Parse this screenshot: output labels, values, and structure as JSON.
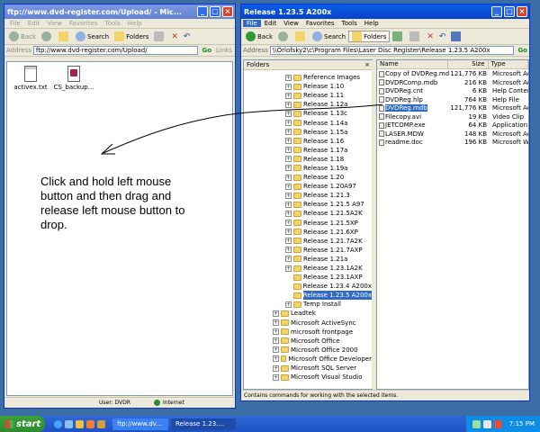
{
  "left_window": {
    "title": "ftp://www.dvd-register.com/Upload/ - Mic...",
    "menu": [
      "File",
      "Edit",
      "View",
      "Favorites",
      "Tools",
      "Help"
    ],
    "toolbar": {
      "back": "Back",
      "search": "Search",
      "folders": "Folders"
    },
    "address_label": "Address",
    "address_value": "ftp://www.dvd-register.com/Upload/",
    "go": "Go",
    "links": "Links",
    "files": [
      {
        "name": "activex.txt",
        "icon": "text-file-icon"
      },
      {
        "name": "CS_backup...",
        "icon": "access-file-icon"
      }
    ],
    "status_user": "User: DVDR",
    "status_zone": "Internet"
  },
  "right_window": {
    "title": "Release 1.23.5 A200x",
    "menu": [
      "File",
      "Edit",
      "View",
      "Favorites",
      "Tools",
      "Help"
    ],
    "toolbar": {
      "back": "Back",
      "search": "Search",
      "folders": "Folders"
    },
    "address_label": "Address",
    "address_value": "\\\\Orlofsky2\\c\\Program Files\\Laser Disc Register\\Release 1.23.5 A200x",
    "go": "Go",
    "folders_header": "Folders",
    "tree": [
      {
        "label": "Reference Images",
        "level": 2,
        "expander": "+"
      },
      {
        "label": "Release 1.10",
        "level": 2,
        "expander": "+"
      },
      {
        "label": "Release 1.11",
        "level": 2,
        "expander": "+"
      },
      {
        "label": "Release 1.12a",
        "level": 2,
        "expander": "+"
      },
      {
        "label": "Release 1.13c",
        "level": 2,
        "expander": "+"
      },
      {
        "label": "Release 1.14a",
        "level": 2,
        "expander": "+"
      },
      {
        "label": "Release 1.15a",
        "level": 2,
        "expander": "+"
      },
      {
        "label": "Release 1.16",
        "level": 2,
        "expander": "+"
      },
      {
        "label": "Release 1.17a",
        "level": 2,
        "expander": "+"
      },
      {
        "label": "Release 1.18",
        "level": 2,
        "expander": "+"
      },
      {
        "label": "Release 1.19a",
        "level": 2,
        "expander": "+"
      },
      {
        "label": "Release 1.20",
        "level": 2,
        "expander": "+"
      },
      {
        "label": "Release 1.20A97",
        "level": 2,
        "expander": "+"
      },
      {
        "label": "Release 1.21.3",
        "level": 2,
        "expander": "+"
      },
      {
        "label": "Release 1.21.5 A97",
        "level": 2,
        "expander": "+"
      },
      {
        "label": "Release 1.21.5A2K",
        "level": 2,
        "expander": "+"
      },
      {
        "label": "Release 1.21.5XP",
        "level": 2,
        "expander": "+"
      },
      {
        "label": "Release 1.21.6XP",
        "level": 2,
        "expander": "+"
      },
      {
        "label": "Release 1.21.7A2K",
        "level": 2,
        "expander": "+"
      },
      {
        "label": "Release 1.21.7AXP",
        "level": 2,
        "expander": "+"
      },
      {
        "label": "Release 1.21a",
        "level": 2,
        "expander": "+"
      },
      {
        "label": "Release 1.23.1A2K",
        "level": 2,
        "expander": "+"
      },
      {
        "label": "Release 1.23.1AXP",
        "level": 2,
        "expander": ""
      },
      {
        "label": "Release 1.23.4 A200x",
        "level": 2,
        "expander": ""
      },
      {
        "label": "Release 1.23.5 A200x",
        "level": 2,
        "expander": "",
        "selected": true
      },
      {
        "label": "Temp Install",
        "level": 2,
        "expander": "+"
      },
      {
        "label": "Leadtek",
        "level": 1,
        "expander": "+"
      },
      {
        "label": "Microsoft ActiveSync",
        "level": 1,
        "expander": "+"
      },
      {
        "label": "microsoft frontpage",
        "level": 1,
        "expander": "+"
      },
      {
        "label": "Microsoft Office",
        "level": 1,
        "expander": "+"
      },
      {
        "label": "Microsoft Office 2000",
        "level": 1,
        "expander": "+"
      },
      {
        "label": "Microsoft Office Developer",
        "level": 1,
        "expander": "+"
      },
      {
        "label": "Microsoft SQL Server",
        "level": 1,
        "expander": "+"
      },
      {
        "label": "Microsoft Visual Studio",
        "level": 1,
        "expander": "+"
      }
    ],
    "columns": {
      "name": "Name",
      "size": "Size",
      "type": "Type"
    },
    "files": [
      {
        "name": "Copy of DVDReg.mdb",
        "size": "121,776 KB",
        "type": "Microsoft Ac"
      },
      {
        "name": "DVDRComp.mdb",
        "size": "216 KB",
        "type": "Microsoft Ac"
      },
      {
        "name": "DVDReg.cnt",
        "size": "6 KB",
        "type": "Help Conten"
      },
      {
        "name": "DVDReg.hlp",
        "size": "764 KB",
        "type": "Help File"
      },
      {
        "name": "DVDReg.mdb",
        "size": "121,776 KB",
        "type": "Microsoft Ac",
        "selected": true
      },
      {
        "name": "Filecopy.avi",
        "size": "19 KB",
        "type": "Video Clip"
      },
      {
        "name": "JETCOMP.exe",
        "size": "64 KB",
        "type": "Application"
      },
      {
        "name": "LASER.MDW",
        "size": "148 KB",
        "type": "Microsoft Ac"
      },
      {
        "name": "readme.doc",
        "size": "196 KB",
        "type": "Microsoft W"
      }
    ],
    "status": "Contains commands for working with the selected items."
  },
  "annotation": "Click and hold left mouse button and then drag and release left mouse button to drop.",
  "taskbar": {
    "start": "start",
    "tasks": [
      {
        "label": "ftp://www.dv...",
        "active": false
      },
      {
        "label": "Release 1.23....",
        "active": true
      }
    ],
    "clock": "7:15 PM"
  },
  "colors": {
    "desktop": "#3a6ea5",
    "titlebar": "#0a5ee6",
    "selection": "#316ac5",
    "start": "#3c9e3c"
  }
}
